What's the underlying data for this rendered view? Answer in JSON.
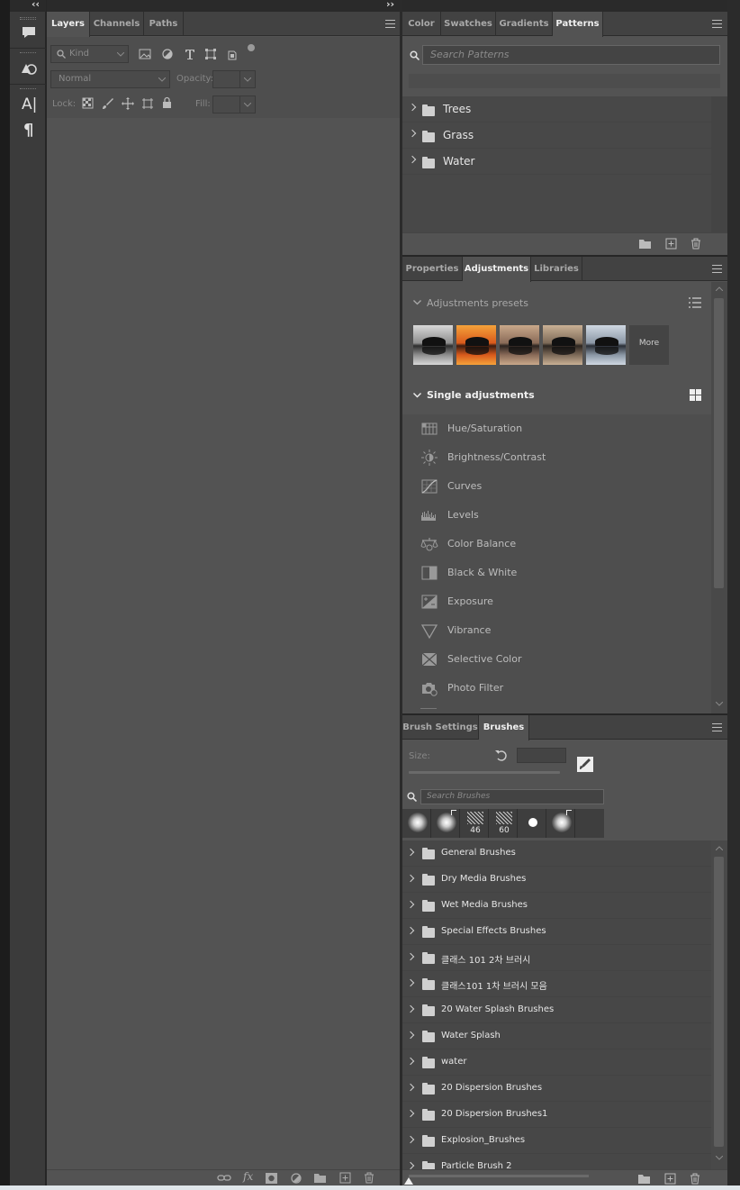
{
  "toolbar_left": {
    "collapse_glyph": "‹‹",
    "tools": [
      {
        "icon": "comment-icon"
      },
      {
        "icon": "shapes-icon"
      },
      {
        "icon": "character-icon",
        "glyph": "A|"
      },
      {
        "icon": "paragraph-icon",
        "glyph": "¶"
      }
    ]
  },
  "layers_panel": {
    "tabs": [
      "Layers",
      "Channels",
      "Paths"
    ],
    "active_tab": "Layers",
    "filter": {
      "kind_placeholder": "Kind"
    },
    "blend_mode": "Normal",
    "opacity_label": "Opacity:",
    "lock_label": "Lock:",
    "fill_label": "Fill:",
    "footer_icons": [
      "link-icon",
      "fx-icon",
      "mask-icon",
      "adjustment-layer-icon",
      "group-icon",
      "new-layer-icon",
      "delete-icon"
    ],
    "fx_glyph": "fx"
  },
  "right_collapse_glyph": "››",
  "patterns_panel": {
    "tabs": [
      "Color",
      "Swatches",
      "Gradients",
      "Patterns"
    ],
    "active_tab": "Patterns",
    "search_placeholder": "Search Patterns",
    "groups": [
      "Trees",
      "Grass",
      "Water"
    ]
  },
  "adjustments_panel": {
    "tabs": [
      "Properties",
      "Adjustments",
      "Libraries"
    ],
    "active_tab": "Adjustments",
    "presets_title": "Adjustments presets",
    "preset_thumbs": [
      {
        "style": "bw",
        "colors": [
          "#d8d8d8",
          "#8e8e8e",
          "#2d2d2d"
        ]
      },
      {
        "style": "sunset",
        "colors": [
          "#f5a23a",
          "#d95a1c",
          "#3a1c10"
        ]
      },
      {
        "style": "warm",
        "colors": [
          "#c9a88a",
          "#8a6b58",
          "#2c2420"
        ]
      },
      {
        "style": "sepia",
        "colors": [
          "#c9b094",
          "#7d6a58",
          "#2c2520"
        ]
      },
      {
        "style": "cool",
        "colors": [
          "#cfd8e2",
          "#8b97a5",
          "#2a2f36"
        ]
      }
    ],
    "more_label": "More",
    "single_title": "Single adjustments",
    "items": [
      {
        "label": "Hue/Saturation",
        "icon": "hue-saturation-icon"
      },
      {
        "label": "Brightness/Contrast",
        "icon": "brightness-contrast-icon"
      },
      {
        "label": "Curves",
        "icon": "curves-icon"
      },
      {
        "label": "Levels",
        "icon": "levels-icon"
      },
      {
        "label": "Color Balance",
        "icon": "color-balance-icon"
      },
      {
        "label": "Black & White",
        "icon": "black-white-icon"
      },
      {
        "label": "Exposure",
        "icon": "exposure-icon"
      },
      {
        "label": "Vibrance",
        "icon": "vibrance-icon"
      },
      {
        "label": "Selective Color",
        "icon": "selective-color-icon"
      },
      {
        "label": "Photo Filter",
        "icon": "photo-filter-icon"
      }
    ]
  },
  "brushes_panel": {
    "tabs": [
      "Brush Settings",
      "Brushes"
    ],
    "active_tab": "Brushes",
    "size_label": "Size:",
    "search_placeholder": "Search Brushes",
    "recent_brushes": [
      {
        "kind": "soft-round",
        "size_label": ""
      },
      {
        "kind": "soft-round-pen",
        "size_label": ""
      },
      {
        "kind": "texture",
        "size_label": "46"
      },
      {
        "kind": "texture-wide",
        "size_label": "60"
      },
      {
        "kind": "hard-round",
        "size_label": ""
      },
      {
        "kind": "soft-round-pen",
        "size_label": ""
      }
    ],
    "groups": [
      "General Brushes",
      "Dry Media Brushes",
      "Wet Media Brushes",
      "Special Effects Brushes",
      "클래스 101 2차 브러시",
      "클래스101 1차 브러시 모음",
      "20 Water Splash Brushes",
      "Water Splash",
      "water",
      "20 Dispersion Brushes",
      "20 Dispersion Brushes1",
      "Explosion_Brushes",
      "Particle Brush 2"
    ]
  }
}
